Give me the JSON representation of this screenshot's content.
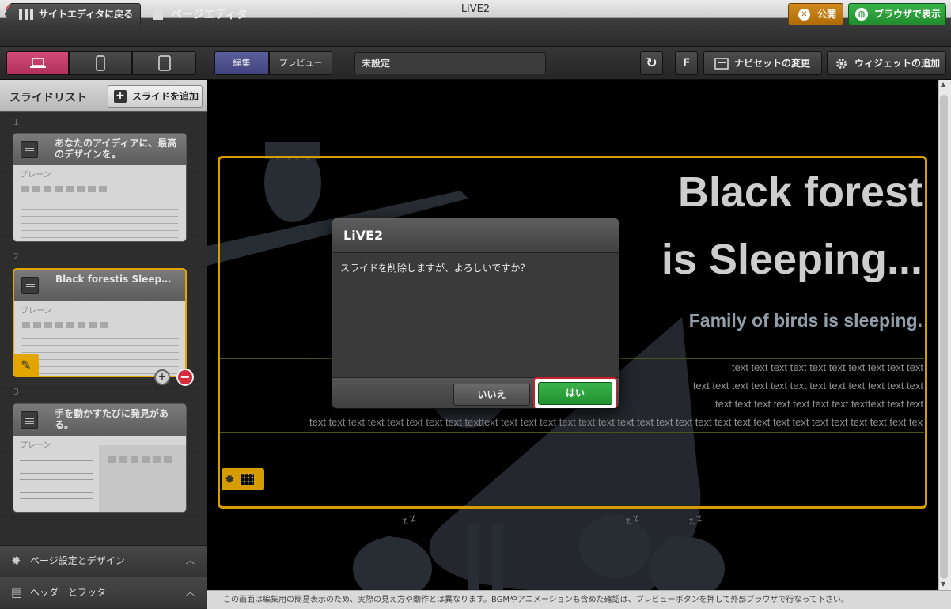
{
  "window": {
    "title": "LiVE2"
  },
  "toolbar": {
    "back_label": "サイトエディタに戻る",
    "page_editor_label": "ページエディタ",
    "publish_label": "公開",
    "browser_label": "ブラウザで表示",
    "mode_edit": "編集",
    "mode_preview": "プレビュー",
    "page_title_value": "未設定",
    "f_label": "F",
    "navi_label": "ナビセットの変更",
    "widget_label": "ウィジェットの追加"
  },
  "sidebar": {
    "title": "スライドリスト",
    "add_label": "スライドを追加",
    "slides": [
      {
        "num": "1",
        "title": "あなたのアイディアに、最高のデザインを。",
        "type": "プレーン"
      },
      {
        "num": "2",
        "title": "Black forestis Sleep…",
        "type": "プレーン"
      },
      {
        "num": "3",
        "title": "手を動かすたびに発見がある。",
        "type": "プレーン"
      }
    ],
    "footer": {
      "page_settings": "ページ設定とデザイン",
      "header_footer": "ヘッダーとフッター"
    }
  },
  "slide": {
    "title_line1": "Black forest",
    "title_line2": "is Sleeping...",
    "subtitle": "Family of birds is sleeping.",
    "text_lines": [
      "text text text text text text text text text text",
      "text text text text text text text text text text text text",
      "text text text text text text text texttext text text",
      "text text text text text text text text texttext text text text text text text text text text text text text text text text text text text text text text text text text text text text text"
    ],
    "zzz": "z z"
  },
  "dialog": {
    "title": "LiVE2",
    "message": "スライドを削除しますが、よろしいですか？",
    "no_label": "いいえ",
    "yes_label": "はい"
  },
  "status_bar": "この画面は編集用の簡易表示のため、実際の見え方や動作とは異なります。BGMやアニメーションも含めた確認は、プレビューボタンを押して外部ブラウザで行なって下さい。",
  "colors": {
    "accent_gold": "#e3a600",
    "pink": "#c33b68",
    "green": "#2aa23a",
    "publish_orange": "#c27b12",
    "delete_red": "#d42c3a"
  }
}
